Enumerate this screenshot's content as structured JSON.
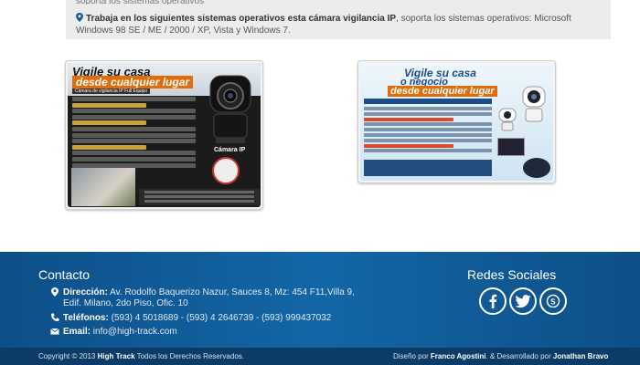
{
  "info": {
    "cut_text": "soporta los sistemas operativos",
    "bold": "Trabaja en los siguientes sistemas operativos esta cámara vigilancia IP",
    "rest": ", soporta los sistemas operativos: Microsoft Windows 98 SE / ME / 2000 / XP, Vista y Windows 7."
  },
  "products": [
    {
      "headline_1": "Vigile su casa",
      "headline_2": "desde cualquier lugar",
      "subtitle": "Cámara de vigilancia IP Full Equipo",
      "camera_label": "Cámara IP"
    },
    {
      "headline_1": "Vigile su casa",
      "headline_2": "o negocio",
      "headline_3": "desde cualquier lugar"
    }
  ],
  "footer": {
    "contact_title": "Contacto",
    "address_label": "Dirección:",
    "address_line_1": "Av. Rodolfo Baquerizo Nazur, Sauces 8, Mz: 454 F11,Villa 9,",
    "address_line_2": "Edif. Milano, 2do Piso, Ofic. 10",
    "phones_label": "Teléfonos:",
    "phones": "(593) 4 5018689 -  (593) 4 2646739 -  (593) 999437032",
    "email_label": "Email:",
    "email": "info@high-track.com",
    "social_title": "Redes Sociales",
    "social": [
      "facebook-icon",
      "twitter-icon",
      "skype-icon"
    ]
  },
  "bottom": {
    "copyright_prefix": "Copyright © 2013 ",
    "brand": "High Track",
    "copyright_suffix": " Todos los Derechos Reservados.",
    "design_prefix": "Diseño por ",
    "designer": "Franco Agostini",
    "dev_prefix": ". & Desarrollado por ",
    "developer": "Jonathan Bravo"
  },
  "colors": {
    "footer_blue": "#1366a6",
    "bottom_bar": "#0b3b66",
    "accent_orange": "#e36c0a"
  }
}
